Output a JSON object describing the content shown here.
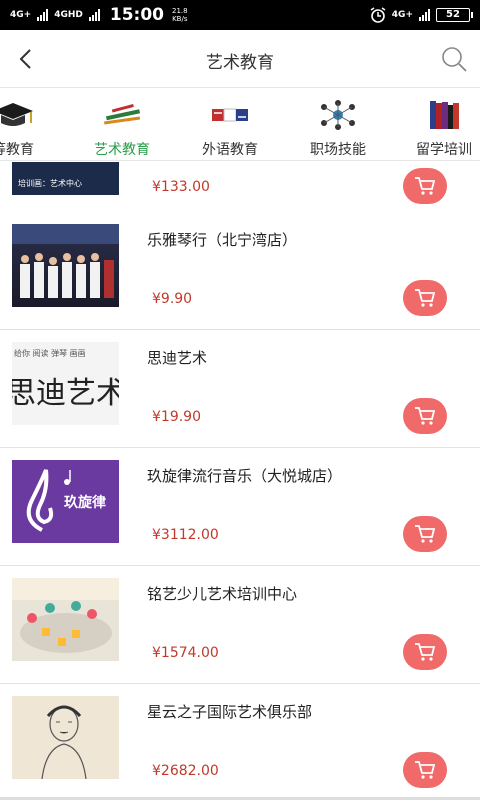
{
  "status_bar": {
    "network1": "4G+",
    "network2": "4GHD",
    "time": "15:00",
    "speed_value": "21.8",
    "speed_unit": "KB/s",
    "network_right": "4G+",
    "battery": "52"
  },
  "header": {
    "title": "艺术教育",
    "back_icon": "chevron-left-icon",
    "search_icon": "search-icon"
  },
  "categories": [
    {
      "label": "等教育",
      "icon": "graduation-cap-icon",
      "active": false
    },
    {
      "label": "艺术教育",
      "icon": "art-supplies-icon",
      "active": true
    },
    {
      "label": "外语教育",
      "icon": "language-icon",
      "active": false
    },
    {
      "label": "职场技能",
      "icon": "network-people-icon",
      "active": false
    },
    {
      "label": "留学培训",
      "icon": "books-icon",
      "active": false
    }
  ],
  "items": [
    {
      "name": "",
      "price": "¥133.00",
      "thumb_caption": "培训画：艺术中心"
    },
    {
      "name": "乐雅琴行（北宁湾店）",
      "price": "¥9.90"
    },
    {
      "name": "思迪艺术",
      "price": "¥19.90",
      "thumb_text": "思迪艺术",
      "thumb_small": "给你 阅读 弹琴 画画"
    },
    {
      "name": "玖旋律流行音乐（大悦城店）",
      "price": "¥3112.00",
      "thumb_text": "玖旋律"
    },
    {
      "name": "铭艺少儿艺术培训中心",
      "price": "¥1574.00"
    },
    {
      "name": "星云之子国际艺术俱乐部",
      "price": "¥2682.00"
    }
  ],
  "colors": {
    "accent_green": "#2a9d4a",
    "price_red": "#c0392b",
    "cart_button": "#f06a6a"
  }
}
